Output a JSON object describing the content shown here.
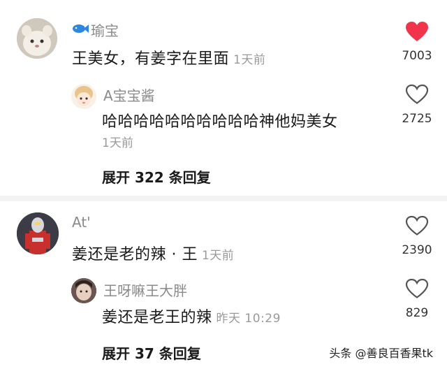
{
  "colors": {
    "liked": "#f0344b",
    "icon_gray": "#555555"
  },
  "comments": [
    {
      "name": "瑜宝",
      "text": "王美女，有姜字在里面",
      "time": "1天前",
      "likes": "7003",
      "liked": true,
      "reply": {
        "name": "A宝宝酱",
        "text": "哈哈哈哈哈哈哈哈哈哈神他妈美女",
        "time": "1天前",
        "likes": "2725"
      },
      "expand_label": "展开 322 条回复"
    },
    {
      "name": "At'",
      "text": "姜还是老的辣 · 王",
      "time": "1天前",
      "likes": "2390",
      "liked": false,
      "reply": {
        "name": "王呀嘛王大胖",
        "text": "姜还是老王的辣",
        "time": "昨天 10:29",
        "likes": "829"
      },
      "expand_label": "展开 37 条回复"
    }
  ],
  "watermark": "头条 @善良百香果tk"
}
